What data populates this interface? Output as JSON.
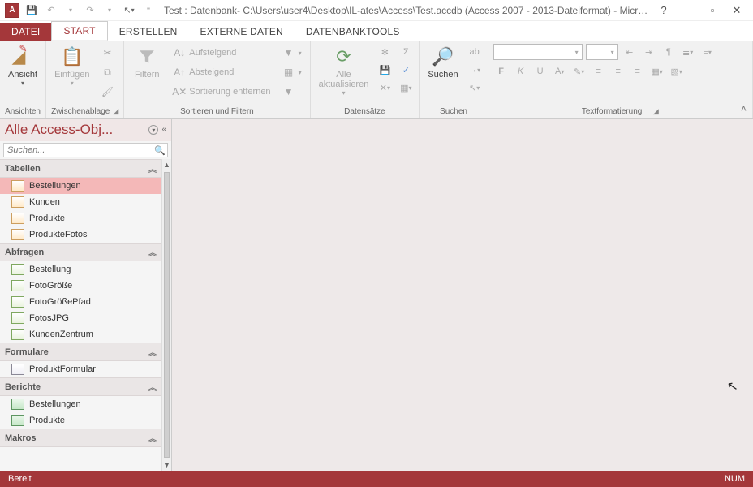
{
  "title": "Test : Datenbank- C:\\Users\\user4\\Desktop\\IL-ates\\Access\\Test.accdb (Access 2007 - 2013-Dateiformat) - Micros...",
  "qat": {
    "app": "A"
  },
  "tabs": {
    "file": "DATEI",
    "start": "START",
    "erstellen": "ERSTELLEN",
    "externe": "EXTERNE DATEN",
    "tools": "DATENBANKTOOLS"
  },
  "ribbon": {
    "ansichten": {
      "ansicht": "Ansicht",
      "label": "Ansichten"
    },
    "zwischenablage": {
      "einfuegen": "Einfügen",
      "label": "Zwischenablage"
    },
    "sortfilter": {
      "filtern": "Filtern",
      "aufsteigend": "Aufsteigend",
      "absteigend": "Absteigend",
      "entfernen": "Sortierung entfernen",
      "label": "Sortieren und Filtern"
    },
    "datensaetze": {
      "alle": "Alle",
      "aktualisieren": "aktualisieren",
      "label": "Datensätze"
    },
    "suchen": {
      "suchen": "Suchen",
      "label": "Suchen"
    },
    "text": {
      "bold": "F",
      "italic": "K",
      "underline": "U",
      "label": "Textformatierung"
    }
  },
  "nav": {
    "header": "Alle Access-Obj...",
    "search_placeholder": "Suchen...",
    "cats": {
      "tabellen": "Tabellen",
      "abfragen": "Abfragen",
      "formulare": "Formulare",
      "berichte": "Berichte",
      "makros": "Makros"
    },
    "tables": [
      "Bestellungen",
      "Kunden",
      "Produkte",
      "ProdukteFotos"
    ],
    "queries": [
      "Bestellung",
      "FotoGröße",
      "FotoGrößePfad",
      "FotosJPG",
      "KundenZentrum"
    ],
    "forms": [
      "ProduktFormular"
    ],
    "reports": [
      "Bestellungen",
      "Produkte"
    ]
  },
  "status": {
    "left": "Bereit",
    "right": "NUM"
  }
}
